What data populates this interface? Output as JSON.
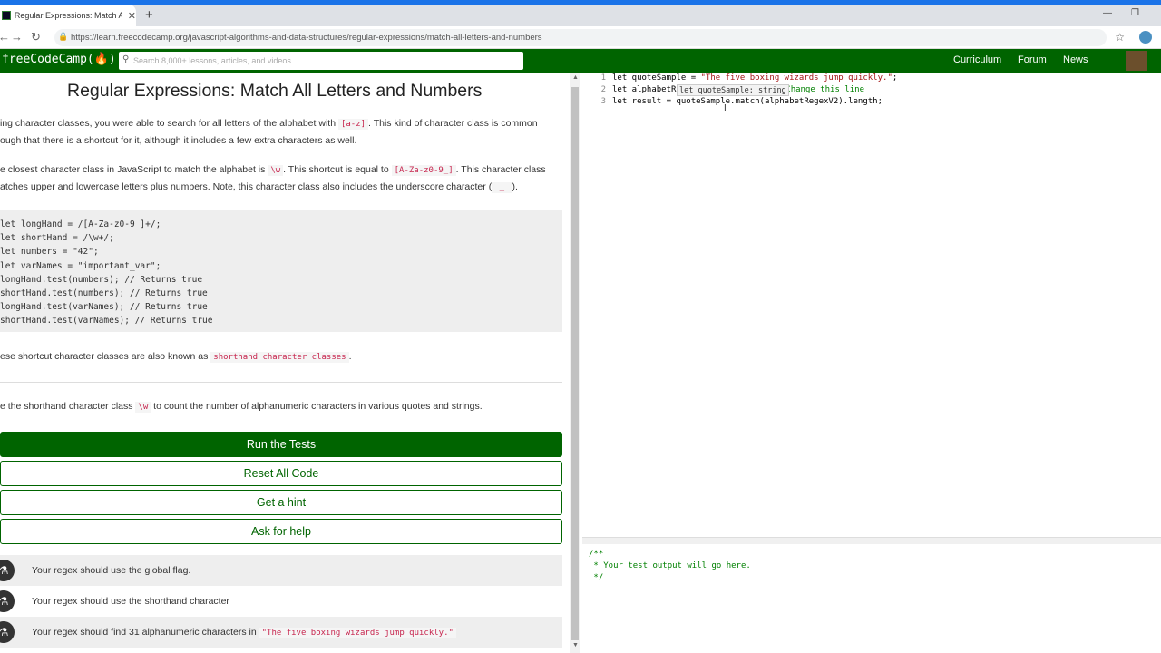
{
  "browser": {
    "tab_title": "Regular Expressions: Match All Le",
    "new_tab": "+",
    "close_tab": "✕",
    "window_controls": [
      "—",
      "❐"
    ],
    "url": "https://learn.freecodecamp.org/javascript-algorithms-and-data-structures/regular-expressions/match-all-letters-and-numbers"
  },
  "nav": {
    "logo": "freeCodeCamp(🔥)",
    "search_placeholder": "Search 8,000+ lessons, articles, and videos",
    "links": [
      "Curriculum",
      "Forum",
      "News"
    ]
  },
  "lesson": {
    "title": "Regular Expressions: Match All Letters and Numbers",
    "p1_a": "ing character classes, you were able to search for all letters of the alphabet with ",
    "p1_code": "[a-z]",
    "p1_b": ". This kind of character class is common",
    "p1_line2": "ough that there is a shortcut for it, although it includes a few extra characters as well.",
    "p2_a": "e closest character class in JavaScript to match the alphabet is ",
    "p2_code1": "\\w",
    "p2_b": ". This shortcut is equal to ",
    "p2_code2": "[A-Za-z0-9_]",
    "p2_c": ". This character class",
    "p2_line2_a": "atches upper and lowercase letters plus numbers. Note, this character class also includes the underscore character (",
    "p2_code3": " _ ",
    "p2_line2_b": ").",
    "code_lines": [
      "let longHand = /[A-Za-z0-9_]+/;",
      "let shortHand = /\\w+/;",
      "let numbers = \"42\";",
      "let varNames = \"important_var\";",
      "longHand.test(numbers); // Returns true",
      "shortHand.test(numbers); // Returns true",
      "longHand.test(varNames); // Returns true",
      "shortHand.test(varNames); // Returns true"
    ],
    "p3_a": "ese shortcut character classes are also known as ",
    "p3_code": "shorthand character classes",
    "p3_b": ".",
    "p4_a": "e the shorthand character class ",
    "p4_code": "\\w",
    "p4_b": " to count the number of alphanumeric characters in various quotes and strings."
  },
  "buttons": {
    "run": "Run the Tests",
    "reset": "Reset All Code",
    "hint": "Get a hint",
    "help": "Ask for help"
  },
  "tests": {
    "t1": "Your regex should use the global flag.",
    "t2": "Your regex should use the shorthand character",
    "t3_a": "Your regex should find 31 alphanumeric characters in ",
    "t3_code": "\"The five boxing wizards jump quickly.\""
  },
  "editor": {
    "lines": [
      {
        "n": "1",
        "a": "let quoteSample = ",
        "s": "\"The five boxing wizards jump quickly.\"",
        "b": ";"
      },
      {
        "n": "2",
        "a": "let alphabetR",
        "c": "/ Change this line"
      },
      {
        "n": "3",
        "a": "let result = quoteSample.match(alphabetRegexV2).length;"
      }
    ],
    "tooltip": "let quoteSample: string",
    "cursor": "I"
  },
  "output": {
    "text": "/**\n * Your test output will go here.\n */"
  },
  "scroll_arrows": [
    "▲",
    "▼"
  ],
  "icons": {
    "lock": "🔒",
    "search": "⚲",
    "star": "☆",
    "back": "←",
    "forward": "→",
    "reload": "↻",
    "flask": "⚗"
  }
}
